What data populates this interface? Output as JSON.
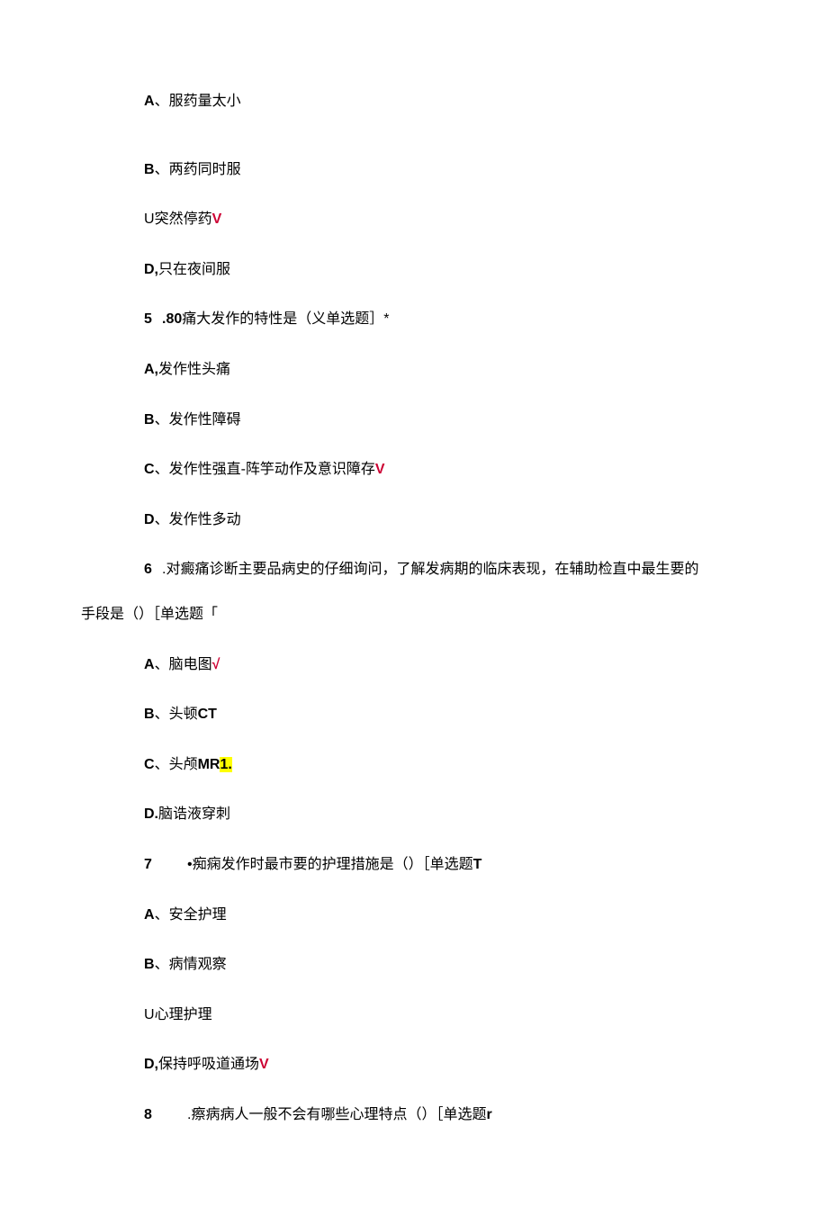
{
  "q4_continuation": {
    "optA": {
      "label": "A",
      "sep": "、",
      "text": "服药量太小"
    },
    "optB": {
      "label": "B",
      "sep": "、",
      "text": "两药同时服"
    },
    "optC": {
      "label": "U",
      "text": "突然停药",
      "mark": "V"
    },
    "optD": {
      "label": "D,",
      "text": "只在夜间服"
    }
  },
  "q5": {
    "num": "5",
    "stem_prefix": ".80",
    "stem": "痛大发作的特性是（义单选题］*",
    "optA": {
      "label": "A,",
      "text": "发作性头痛"
    },
    "optB": {
      "label": "B",
      "sep": "、",
      "text": "发作性障碍"
    },
    "optC": {
      "label": "C",
      "sep": "、",
      "text": "发作性强直-阵竽动作及意识障存",
      "mark": "V"
    },
    "optD": {
      "label": "D",
      "sep": "、",
      "text": "发作性多动"
    }
  },
  "q6": {
    "num": "6",
    "stem_line1": ".对癜痛诊断主要品病史的仔细询问，了解发病期的临床表现，在辅助检直中最生要的",
    "stem_line2": "手段是（）［单选题「",
    "optA": {
      "label": "A",
      "sep": "、",
      "text": "脑电图",
      "mark": "√"
    },
    "optB": {
      "label": "B",
      "sep": "、",
      "text": "头顿",
      "suffix": "CT"
    },
    "optC": {
      "label": "C",
      "sep": "、",
      "text": "头颅",
      "suffix_pre": "MR",
      "suffix_hl": "1."
    },
    "optD": {
      "label": "D.",
      "text": "脑诰液穿刺"
    }
  },
  "q7": {
    "num": "7",
    "stem": "•痴痫发作时最市要的护理措施是（）［单选题",
    "stem_suffix": "T",
    "optA": {
      "label": "A",
      "sep": "、",
      "text": "安全护理"
    },
    "optB": {
      "label": "B",
      "sep": "、",
      "text": "病情观察"
    },
    "optC": {
      "label": "U",
      "text": "心理护理"
    },
    "optD": {
      "label": "D,",
      "text": "保持呼吸道通场",
      "mark": "V"
    }
  },
  "q8": {
    "num": "8",
    "stem": ".瘵病病人一般不会有哪些心理特点（）［单选题",
    "stem_suffix": "r"
  }
}
